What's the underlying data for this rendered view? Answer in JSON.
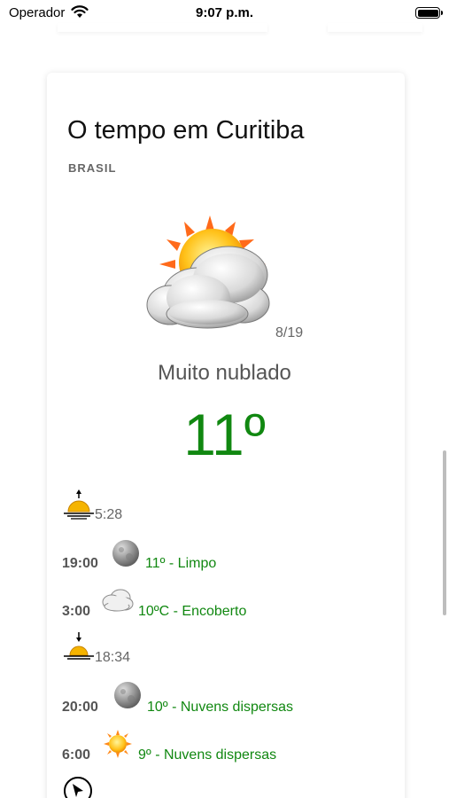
{
  "status_bar": {
    "carrier": "Operador",
    "time": "9:07 p.m."
  },
  "weather": {
    "city_title": "O tempo em Curitiba",
    "country": "BRASIL",
    "image_counter": "8/19",
    "condition": "Muito nublado",
    "temperature": "11º",
    "main_icon": "partly-cloudy-sun-icon"
  },
  "forecast": [
    {
      "type": "sunrise",
      "icon": "sunrise-icon",
      "time": "5:28"
    },
    {
      "type": "hour",
      "time": "19:00",
      "icon": "moon-icon",
      "desc": "11º - Limpo"
    },
    {
      "type": "hour",
      "time": "3:00",
      "icon": "cloud-icon",
      "desc": "10ºC - Encoberto"
    },
    {
      "type": "sunset",
      "icon": "sunset-icon",
      "time": "18:34"
    },
    {
      "type": "hour",
      "time": "20:00",
      "icon": "moon-icon",
      "desc": "10º - Nuvens dispersas"
    },
    {
      "type": "hour",
      "time": "6:00",
      "icon": "sun-icon",
      "desc": "9º - Nuvens dispersas"
    }
  ],
  "colors": {
    "temperature": "#118811",
    "muted_text": "#666666"
  }
}
